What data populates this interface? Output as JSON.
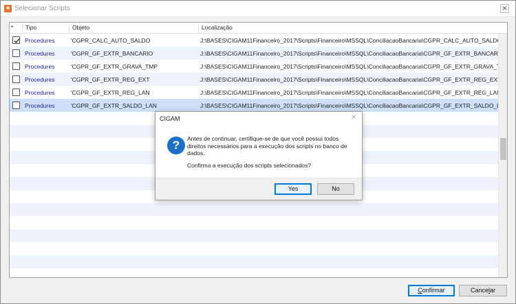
{
  "window": {
    "title": "Selecionar Scripts",
    "close_glyph": "✕"
  },
  "grid": {
    "columns": [
      "*",
      "Tipo",
      "Objeto",
      "Localização"
    ],
    "rows": [
      {
        "checked": true,
        "tipo": "Procedures",
        "objeto": "'CGPR_CALC_AUTO_SALDO",
        "localizacao": "J:\\BASES\\CIGAM11Financeiro_2017\\Scripts\\Financeiro\\MSSQL\\ConciliacaoBancaria\\CGPR_CALC_AUTO_SALDO.prc"
      },
      {
        "checked": false,
        "tipo": "Procedures",
        "objeto": "'CGPR_GF_EXTR_BANCARIO",
        "localizacao": "J:\\BASES\\CIGAM11Financeiro_2017\\Scripts\\Financeiro\\MSSQL\\ConciliacaoBancaria\\CGPR_GF_EXTR_BANCARIO.prc"
      },
      {
        "checked": false,
        "tipo": "Procedures",
        "objeto": "'CGPR_GF_EXTR_GRAVA_TMP",
        "localizacao": "J:\\BASES\\CIGAM11Financeiro_2017\\Scripts\\Financeiro\\MSSQL\\ConciliacaoBancaria\\CGPR_GF_EXTR_GRAVA_TMP.prc"
      },
      {
        "checked": false,
        "tipo": "Procedures",
        "objeto": "'CGPR_GF_EXTR_REG_EXT",
        "localizacao": "J:\\BASES\\CIGAM11Financeiro_2017\\Scripts\\Financeiro\\MSSQL\\ConciliacaoBancaria\\CGPR_GF_EXTR_REG_EXT.prc"
      },
      {
        "checked": false,
        "tipo": "Procedures",
        "objeto": "'CGPR_GF_EXTR_REG_LAN",
        "localizacao": "J:\\BASES\\CIGAM11Financeiro_2017\\Scripts\\Financeiro\\MSSQL\\ConciliacaoBancaria\\CGPR_GF_EXTR_REG_LAN.prc"
      },
      {
        "checked": false,
        "tipo": "Procedures",
        "objeto": "'CGPR_GF_EXTR_SALDO_LAN",
        "localizacao": "J:\\BASES\\CIGAM11Financeiro_2017\\Scripts\\Financeiro\\MSSQL\\ConciliacaoBancaria\\CGPR_GF_EXTR_SALDO_LAN.prc"
      }
    ]
  },
  "buttons": {
    "confirm_rest": "onfirmar",
    "confirm_mnemonic": "C",
    "cancel_prefix": "Cance",
    "cancel_mnemonic": "l",
    "cancel_rest": "ar"
  },
  "dialog": {
    "title": "CIGAM",
    "close_glyph": "✕",
    "icon_glyph": "?",
    "message": "Antes de continuar, certifique-se de que você possui todos direitos necessários para a execução dos scripts no banco de dados.",
    "question": "Confirma a execução dos scripts selecionados?",
    "yes_label": "Yes",
    "no_label": "No"
  },
  "colors": {
    "accent": "#0078d7",
    "selected_row": "#cde0f7",
    "question_icon": "#1e6fc7"
  }
}
